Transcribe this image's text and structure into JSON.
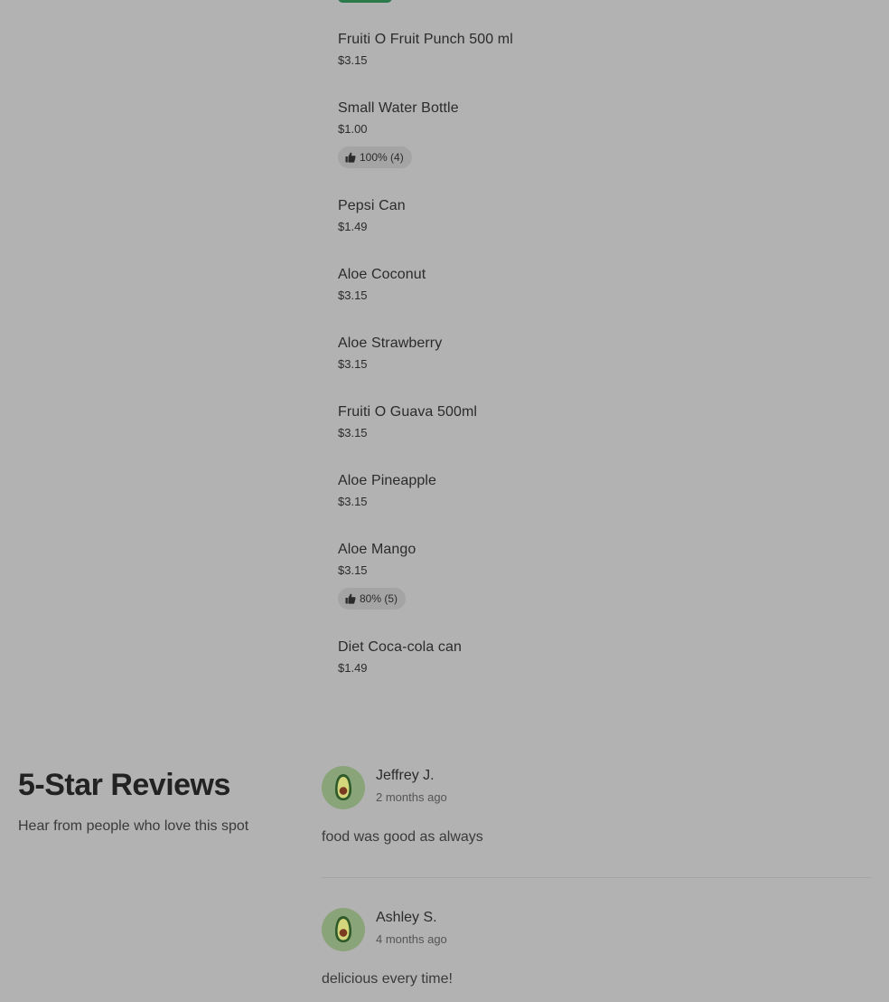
{
  "menu": {
    "items": [
      {
        "name": "Fruiti O Fruit Punch 500 ml",
        "price": "$3.15"
      },
      {
        "name": "Small Water Bottle",
        "price": "$1.00",
        "rating": "100% (4)"
      },
      {
        "name": "Pepsi Can",
        "price": "$1.49"
      },
      {
        "name": "Aloe Coconut",
        "price": "$3.15"
      },
      {
        "name": "Aloe Strawberry",
        "price": "$3.15"
      },
      {
        "name": "Fruiti O Guava 500ml",
        "price": "$3.15"
      },
      {
        "name": "Aloe Pineapple",
        "price": "$3.15"
      },
      {
        "name": "Aloe Mango",
        "price": "$3.15",
        "rating": "80% (5)"
      },
      {
        "name": "Diet Coca-cola can",
        "price": "$1.49"
      }
    ]
  },
  "reviews": {
    "heading": "5-Star Reviews",
    "subheading": "Hear from people who love this spot",
    "list": [
      {
        "name": "Jeffrey J.",
        "time": "2 months ago",
        "text": "food was good as always",
        "avatar_icon": "avocado-icon"
      },
      {
        "name": "Ashley S.",
        "time": "4 months ago",
        "text": "delicious every time!",
        "avatar_icon": "avocado-icon"
      }
    ]
  },
  "colors": {
    "background": "#b2b2b2",
    "badge": "#a4a4a4",
    "accent_green": "#2a7a4a"
  }
}
